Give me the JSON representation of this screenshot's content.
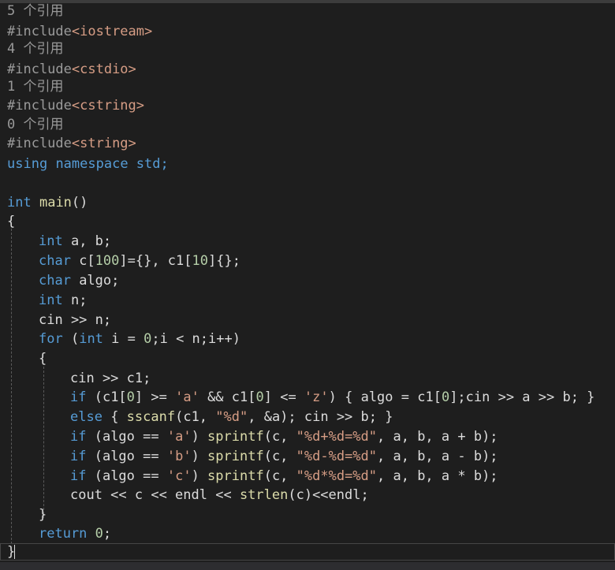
{
  "editor": {
    "codelens": [
      "5 个引用",
      "4 个引用",
      "1 个引用",
      "0 个引用"
    ],
    "includes": [
      {
        "directive": "#include",
        "header": "<iostream>"
      },
      {
        "directive": "#include",
        "header": "<cstdio>"
      },
      {
        "directive": "#include",
        "header": "<cstring>"
      },
      {
        "directive": "#include",
        "header": "<string>"
      }
    ],
    "lines": {
      "using": "using namespace std;",
      "main_sig": "int main()",
      "open_main": "{",
      "decl_ab": "int a, b;",
      "decl_c": "char c[100]={}, c1[10]{};",
      "decl_algo": "char algo;",
      "decl_n": "int n;",
      "cin_n": "cin >> n;",
      "for_line": "for (int i = 0;i < n;i++)",
      "open_for": "{",
      "cin_c1": "cin >> c1;",
      "if_range": "if (c1[0] >= 'a' && c1[0] <= 'z') { algo = c1[0];cin >> a >> b; }",
      "else_line": "else { sscanf(c1, \"%d\", &a); cin >> b; }",
      "if_add": "if (algo == 'a') sprintf(c, \"%d+%d=%d\", a, b, a + b);",
      "if_sub": "if (algo == 'b') sprintf(c, \"%d-%d=%d\", a, b, a - b);",
      "if_mul": "if (algo == 'c') sprintf(c, \"%d*%d=%d\", a, b, a * b);",
      "cout_line": "cout << c << endl << strlen(c)<<endl;",
      "close_for": "}",
      "return_line": "return 0;",
      "close_main": "}"
    }
  },
  "colors": {
    "background": "#1e1e1e",
    "keyword": "#569cd6",
    "function": "#dcdcaa",
    "string": "#d69d85",
    "number": "#b5cea8",
    "text": "#dcdcdc",
    "codelens": "#999999"
  }
}
